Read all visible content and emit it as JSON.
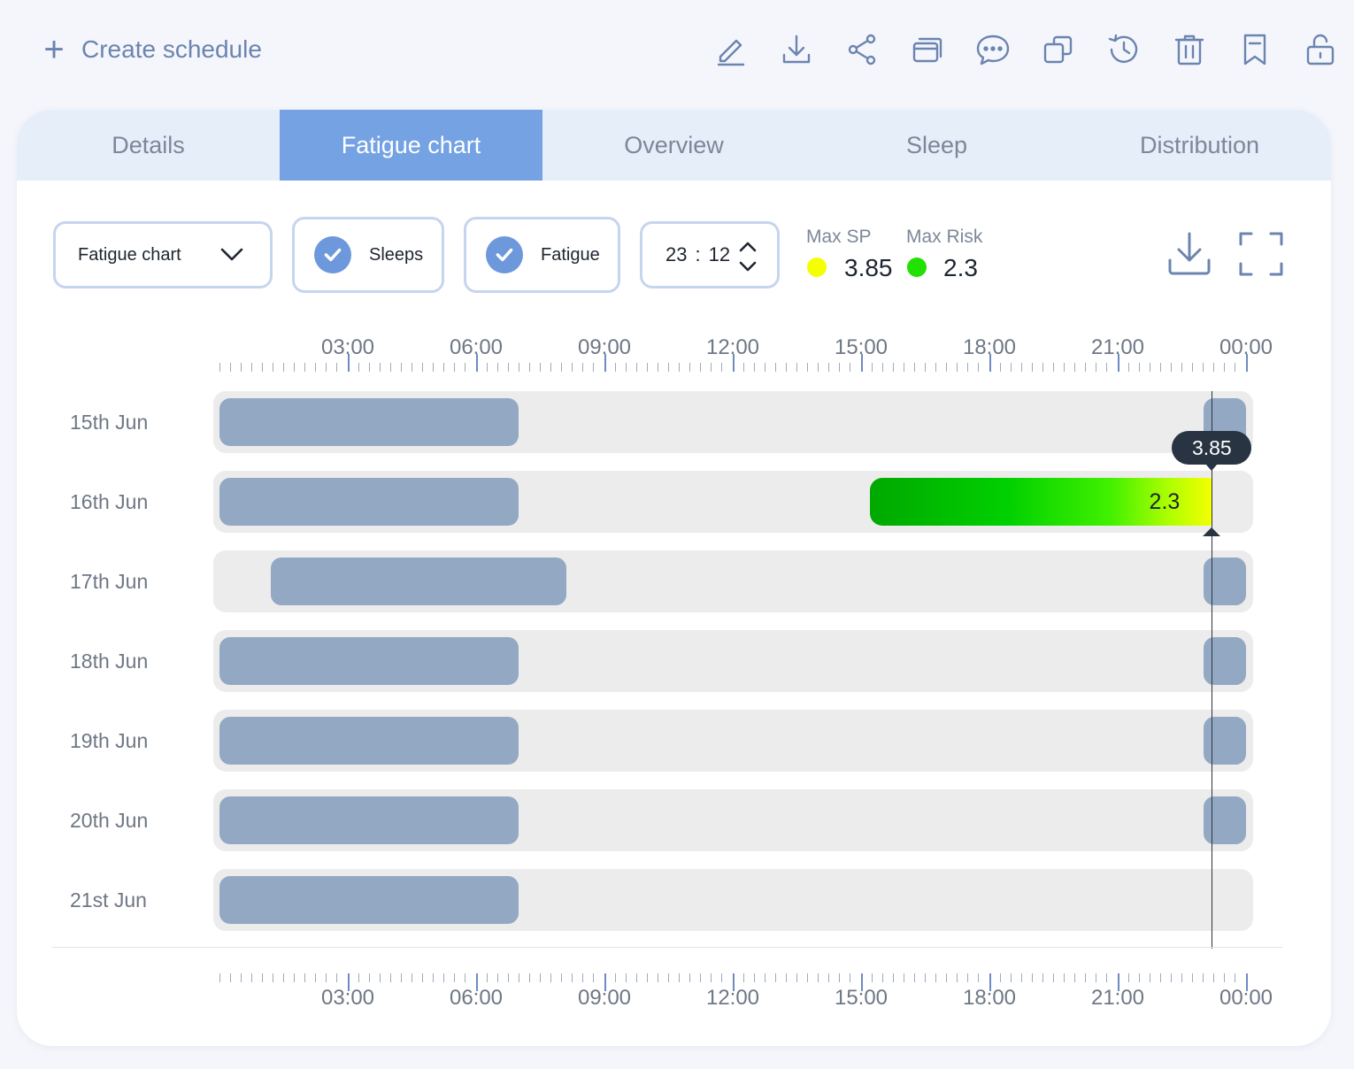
{
  "header": {
    "create_label": "Create schedule",
    "toolbar_icons": [
      "edit-icon",
      "download-icon",
      "share-icon",
      "windows-icon",
      "comment-icon",
      "copy-icon",
      "history-icon",
      "trash-icon",
      "bookmark-icon",
      "unlock-icon"
    ]
  },
  "tabs": [
    {
      "label": "Details",
      "active": false
    },
    {
      "label": "Fatigue chart",
      "active": true
    },
    {
      "label": "Overview",
      "active": false
    },
    {
      "label": "Sleep",
      "active": false
    },
    {
      "label": "Distribution",
      "active": false
    }
  ],
  "controls": {
    "chart_select": "Fatigue chart",
    "sleeps_label": "Sleeps",
    "sleeps_checked": true,
    "fatigue_label": "Fatigue",
    "fatigue_checked": true,
    "time_hours": "23",
    "time_sep": ":",
    "time_minutes": "12"
  },
  "legend": {
    "max_sp_label": "Max SP",
    "max_sp_value": "3.85",
    "max_sp_color": "#f4ff00",
    "max_risk_label": "Max Risk",
    "max_risk_value": "2.3",
    "max_risk_color": "#22e000"
  },
  "chart_data": {
    "type": "timeline",
    "x_range_hours": [
      0,
      24
    ],
    "tick_labels": [
      "03:00",
      "06:00",
      "09:00",
      "12:00",
      "15:00",
      "18:00",
      "21:00",
      "00:00"
    ],
    "tick_hours": [
      3,
      6,
      9,
      12,
      15,
      18,
      21,
      24
    ],
    "cursor_hour": 23.2,
    "cursor_label": "3.85",
    "rows": [
      {
        "label": "15th Jun",
        "sleeps": [
          [
            0,
            7
          ],
          [
            23,
            24
          ]
        ],
        "fatigue": null
      },
      {
        "label": "16th Jun",
        "sleeps": [
          [
            0,
            7
          ]
        ],
        "fatigue": {
          "start": 15.2,
          "end": 23.2,
          "label": "2.3"
        }
      },
      {
        "label": "17th Jun",
        "sleeps": [
          [
            1.2,
            8.1
          ],
          [
            23,
            24
          ]
        ],
        "fatigue": null
      },
      {
        "label": "18th Jun",
        "sleeps": [
          [
            0,
            7
          ],
          [
            23,
            24
          ]
        ],
        "fatigue": null
      },
      {
        "label": "19th Jun",
        "sleeps": [
          [
            0,
            7
          ],
          [
            23,
            24
          ]
        ],
        "fatigue": null
      },
      {
        "label": "20th Jun",
        "sleeps": [
          [
            0,
            7
          ],
          [
            23,
            24
          ]
        ],
        "fatigue": null
      },
      {
        "label": "21st Jun",
        "sleeps": [
          [
            0,
            7
          ]
        ],
        "fatigue": null
      }
    ],
    "colors": {
      "sleep": "#93a8c3",
      "track": "#ececec",
      "fatigue_start": "#00a800",
      "fatigue_end": "#f4ff00"
    }
  }
}
